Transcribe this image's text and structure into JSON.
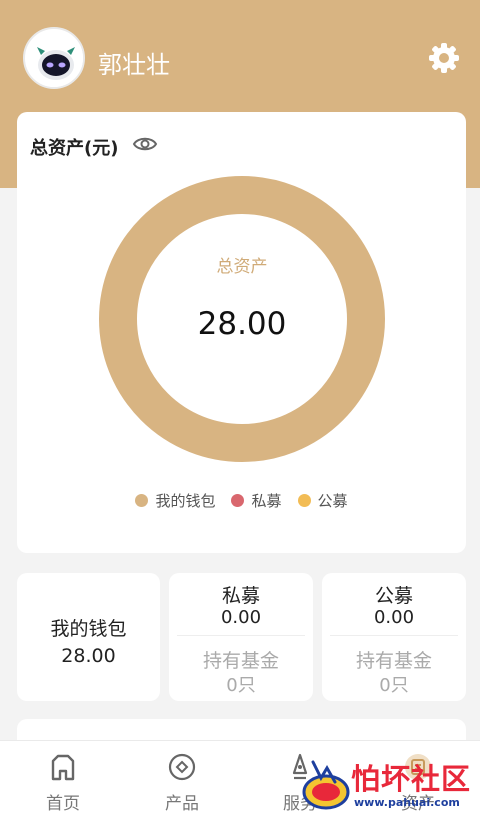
{
  "header": {
    "username": "郭壮壮",
    "avatar_icon": "robot-avatar-icon",
    "settings_icon": "gear-icon"
  },
  "total": {
    "title": "总资产(元)",
    "eye_icon": "eye-icon",
    "center_label": "总资产",
    "center_value": "28.00",
    "legend": [
      {
        "label": "我的钱包",
        "color": "#d8b482"
      },
      {
        "label": "私募",
        "color": "#d9676e"
      },
      {
        "label": "公募",
        "color": "#f2bc55"
      }
    ]
  },
  "chart_data": {
    "type": "pie",
    "categories": [
      "我的钱包",
      "私募",
      "公募"
    ],
    "values": [
      28.0,
      0.0,
      0.0
    ],
    "colors": [
      "#d8b482",
      "#d9676e",
      "#f2bc55"
    ],
    "title": "",
    "legend_position": "bottom"
  },
  "cards": {
    "wallet": {
      "label": "我的钱包",
      "value": "28.00"
    },
    "private": {
      "label": "私募",
      "value": "0.00",
      "hold_label": "持有基金",
      "hold_count": "0只"
    },
    "public": {
      "label": "公募",
      "value": "0.00",
      "hold_label": "持有基金",
      "hold_count": "0只"
    }
  },
  "tabbar": {
    "tabs": [
      {
        "label": "首页",
        "icon": "home-icon"
      },
      {
        "label": "产品",
        "icon": "product-icon"
      },
      {
        "label": "服务",
        "icon": "service-icon"
      },
      {
        "label": "资产",
        "icon": "asset-icon"
      }
    ]
  },
  "watermark": {
    "title": "怕坏社区",
    "url": "www.pahuai.com"
  }
}
